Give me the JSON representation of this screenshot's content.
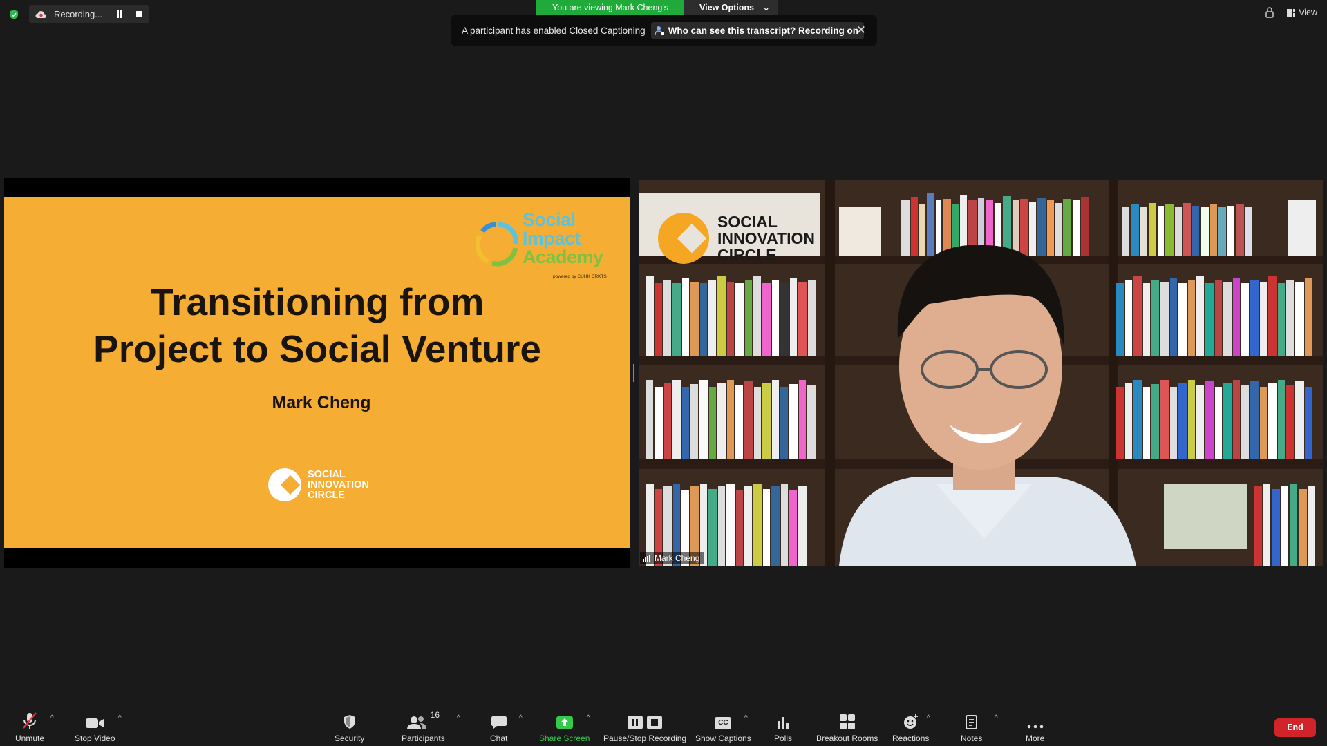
{
  "recording": {
    "label": "Recording..."
  },
  "banner": {
    "viewing": "You are viewing Mark Cheng's screen",
    "view_options": "View Options"
  },
  "notification": {
    "message": "A participant has enabled Closed Captioning",
    "action": "Who can see this transcript? Recording on"
  },
  "top_right": {
    "view_label": "View"
  },
  "slide": {
    "logo_line1": "Social",
    "logo_line2": "Impact",
    "logo_line3": "Academy",
    "logo_powered": "powered by CUHK CRKTS",
    "title_line1": "Transitioning from",
    "title_line2": "Project to Social Venture",
    "presenter": "Mark Cheng",
    "org_line1": "SOCIAL",
    "org_line2": "INNOVATION",
    "org_line3": "CIRCLE"
  },
  "video": {
    "sign_line1": "SOCIAL",
    "sign_line2": "INNOVATION",
    "sign_line3": "CIRCLE",
    "participant_name": "Mark Cheng"
  },
  "toolbar": {
    "unmute": "Unmute",
    "stop_video": "Stop Video",
    "security": "Security",
    "participants": "Participants",
    "participants_count": "16",
    "chat": "Chat",
    "share_screen": "Share Screen",
    "pause_stop_recording": "Pause/Stop Recording",
    "show_captions": "Show Captions",
    "captions_badge": "CC",
    "polls": "Polls",
    "breakout_rooms": "Breakout Rooms",
    "reactions": "Reactions",
    "notes": "Notes",
    "more": "More",
    "end": "End"
  },
  "colors": {
    "slide_bg": "#f5ae33",
    "viewing_banner": "#1faa3a",
    "end_button": "#d1232a",
    "share_screen_green": "#35c94b"
  }
}
